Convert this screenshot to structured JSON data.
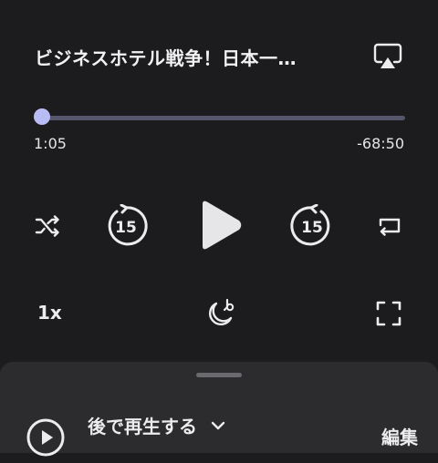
{
  "player": {
    "episode_title": "ビジネスホテル戦争！日本一…",
    "progress": {
      "elapsed": "1:05",
      "remaining": "-68:50",
      "fraction": 0.015
    },
    "playback_speed": "1x",
    "skip_back_seconds": "15",
    "skip_forward_seconds": "15",
    "icons": [
      "airplay-icon",
      "shuffle-icon",
      "skip-back-15-icon",
      "play-icon",
      "skip-forward-15-icon",
      "repeat-icon",
      "sleep-timer-icon",
      "fullscreen-icon"
    ]
  },
  "queue": {
    "title": "後で再生する",
    "edit_label": "編集"
  },
  "colors": {
    "background": "#1c1c1e",
    "sheet": "#2c2c2e",
    "accent": "#b8bcf4",
    "track": "#55556b",
    "text": "#ececee"
  }
}
